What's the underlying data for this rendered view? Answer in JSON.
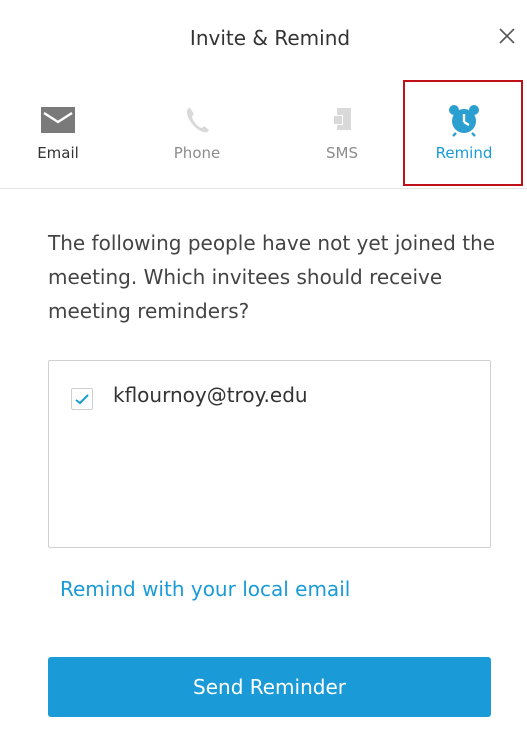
{
  "dialog": {
    "title": "Invite & Remind",
    "close_icon": "close-icon"
  },
  "tabs": [
    {
      "label": "Email",
      "icon": "envelope-icon",
      "state": "default"
    },
    {
      "label": "Phone",
      "icon": "phone-icon",
      "state": "disabled"
    },
    {
      "label": "SMS",
      "icon": "sms-icon",
      "state": "disabled"
    },
    {
      "label": "Remind",
      "icon": "alarm-clock-icon",
      "state": "active"
    }
  ],
  "remind": {
    "prompt": "The following people have not yet joined the meeting. Which invitees should receive meeting reminders?",
    "invitees": [
      {
        "email": "kflournoy@troy.edu",
        "checked": true
      }
    ],
    "local_email_link": "Remind with your local email",
    "send_button": "Send Reminder"
  },
  "colors": {
    "accent": "#1a9bd7",
    "highlight_frame": "#c0101a",
    "active_icon": "#2b9fd0"
  }
}
